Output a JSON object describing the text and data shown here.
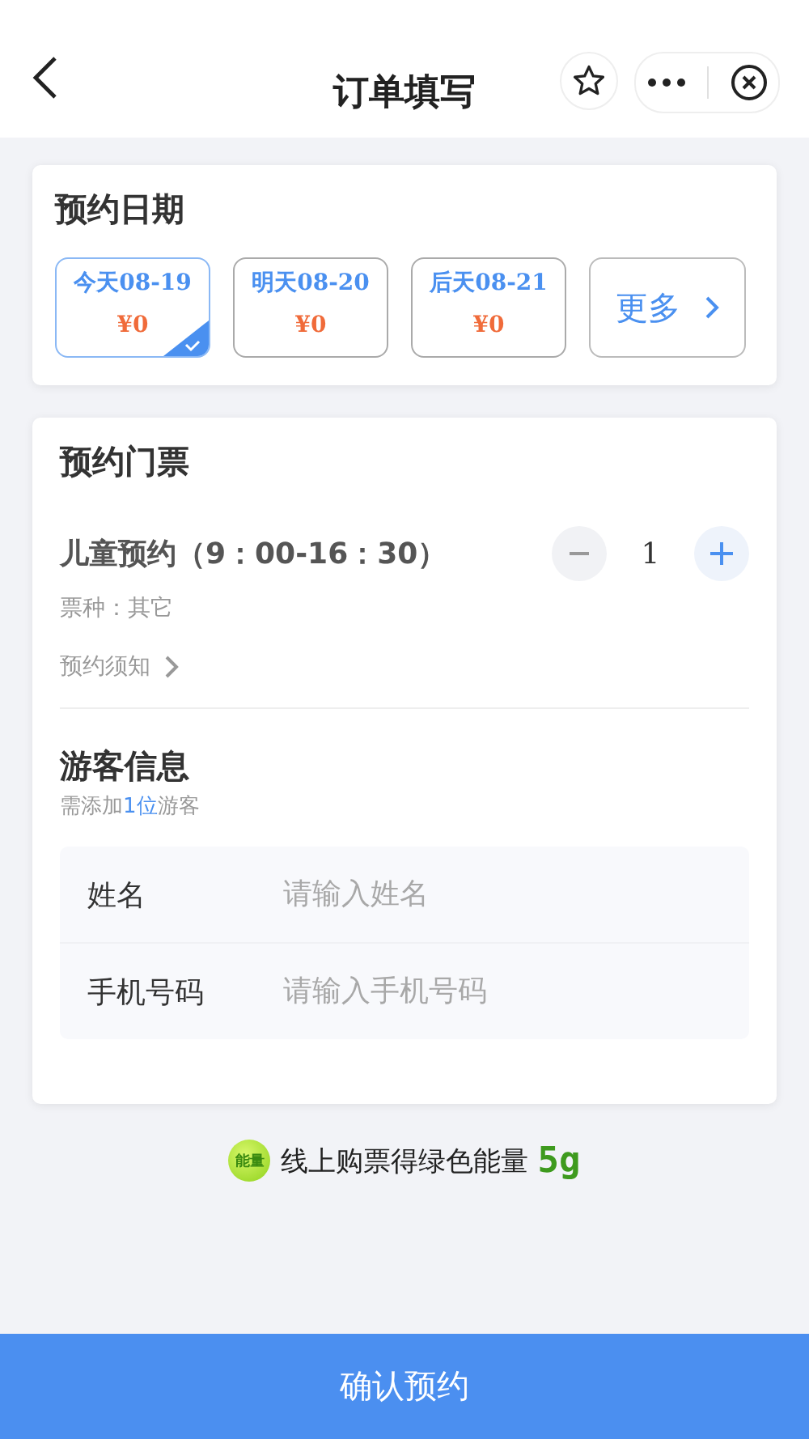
{
  "nav": {
    "title": "订单填写"
  },
  "date_card": {
    "title": "预约日期",
    "dates": [
      {
        "label": "今天08-19",
        "price": "¥0",
        "selected": true
      },
      {
        "label": "明天08-20",
        "price": "¥0",
        "selected": false
      },
      {
        "label": "后天08-21",
        "price": "¥0",
        "selected": false
      }
    ],
    "more": "更多"
  },
  "ticket_card": {
    "title": "预约门票",
    "ticket": {
      "name": "儿童预约（9：00-16：30）",
      "type": "票种：其它",
      "notice": "预约须知",
      "quantity": "1"
    },
    "visitor": {
      "title": "游客信息",
      "hint": "需添加**1位**游客",
      "fields": [
        {
          "label": "姓名",
          "placeholder": "请输入姓名"
        },
        {
          "label": "手机号码",
          "placeholder": "请输入手机号码"
        }
      ]
    }
  },
  "energy": {
    "badge": "能量",
    "text": "线上购票得绿色能量",
    "amount": "5g"
  },
  "confirm_button": "确认预约"
}
